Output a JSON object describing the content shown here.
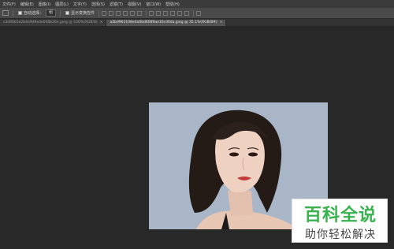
{
  "menubar": {
    "items": [
      "文件(F)",
      "编辑(E)",
      "图像(I)",
      "图层(L)",
      "文字(Y)",
      "选择(S)",
      "滤镜(T)",
      "视图(V)",
      "窗口(W)",
      "帮助(H)"
    ]
  },
  "options": {
    "auto_select_label": "自动选择：",
    "auto_select_value": "组",
    "show_transform_label": "显示变换控件"
  },
  "tabs": [
    {
      "label": "c3d90b5e2b4e9d9ede048b36e.jpeg @ 100%(RGB/8)",
      "active": false,
      "close": "×"
    },
    {
      "label": "a4bd963108e4a6bd6089ae16cd0da.jpeg @ 35.1%(RGB/8#)",
      "active": true,
      "close": "×"
    }
  ],
  "watermark": {
    "top": "百科全说",
    "bottom": "助你轻松解决",
    "color_primary": "#37b24d"
  }
}
